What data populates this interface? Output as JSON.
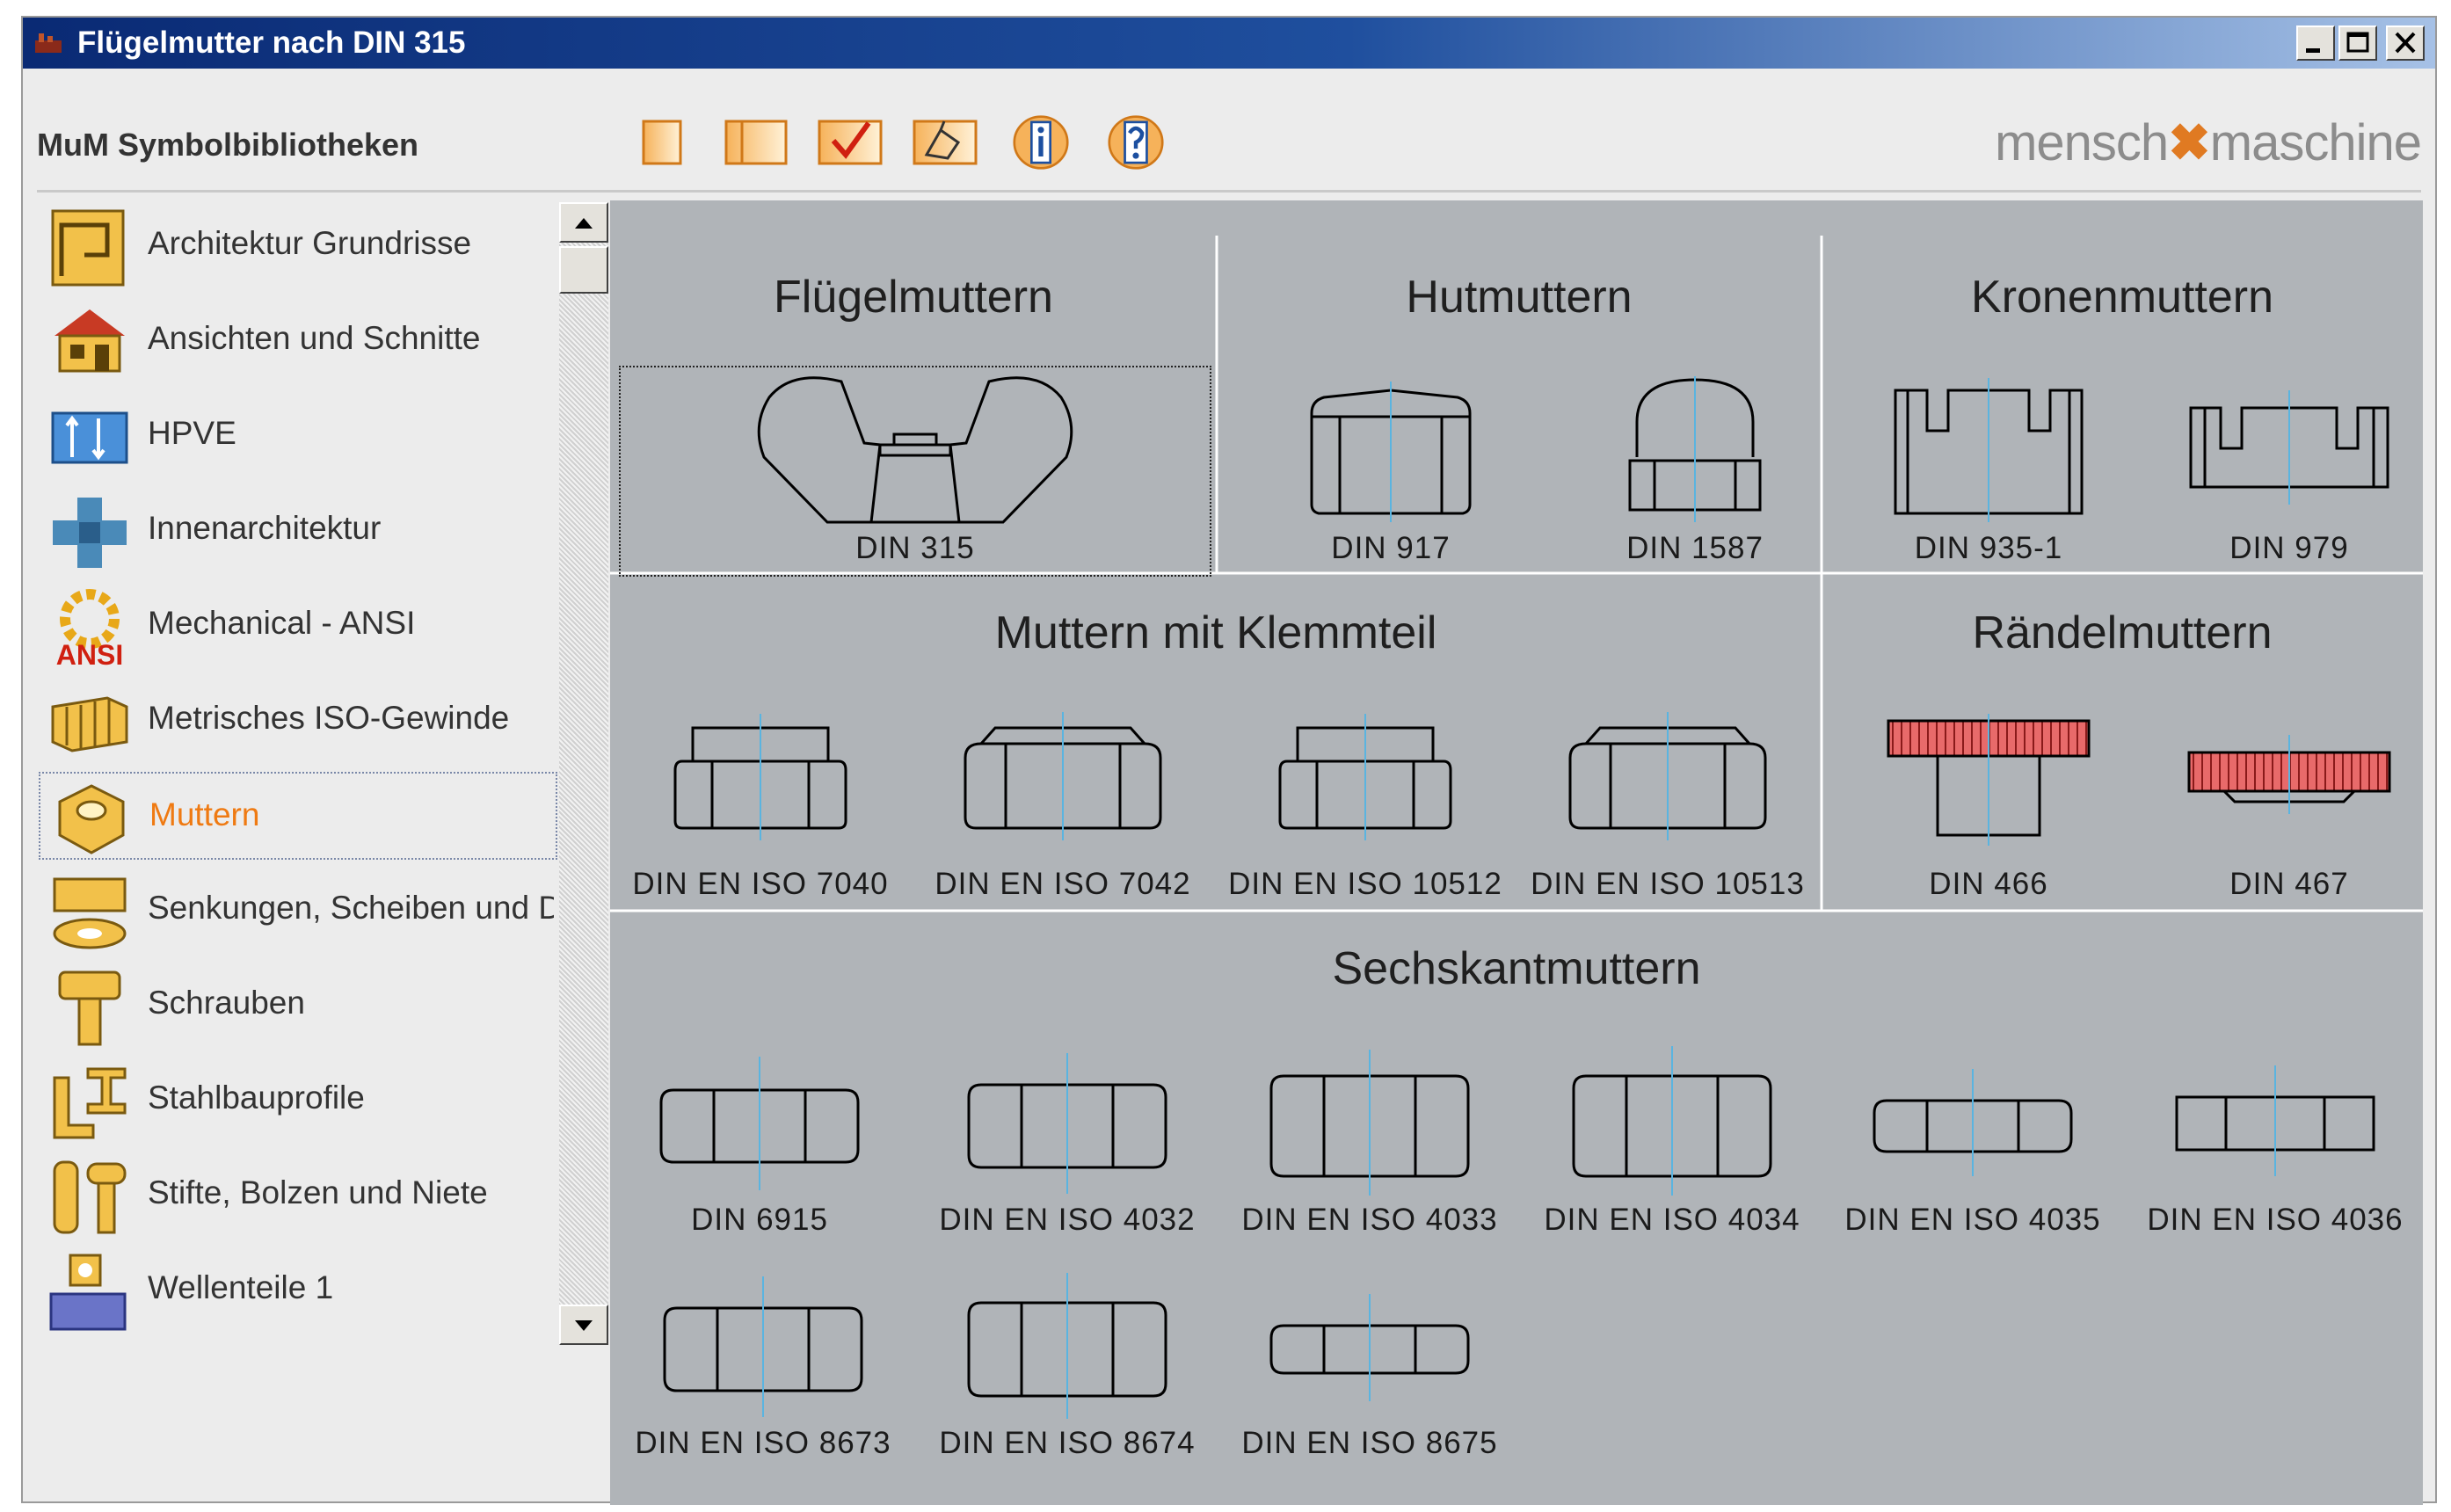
{
  "window": {
    "title": "Flügelmutter nach DIN 315"
  },
  "brand": {
    "library_title": "MuM Symbolbibliotheken",
    "logo_left": "mensch",
    "logo_right": "maschine",
    "toolbar": [
      "new-icon",
      "panel-icon",
      "checkmark-icon",
      "edit-icon",
      "info-icon",
      "help-icon"
    ]
  },
  "sidebar": {
    "items": [
      {
        "label": "Architektur Grundrisse",
        "icon": "floorplan-icon"
      },
      {
        "label": "Ansichten und Schnitte",
        "icon": "house-icon"
      },
      {
        "label": "HPVE",
        "icon": "hpve-icon"
      },
      {
        "label": "Innenarchitektur",
        "icon": "interior-icon"
      },
      {
        "label": "Mechanical - ANSI",
        "icon": "ansi-gear-icon",
        "badge": "ANSI"
      },
      {
        "label": "Metrisches ISO-Gewinde",
        "icon": "thread-icon"
      },
      {
        "label": "Muttern",
        "icon": "nut-icon",
        "selected": true
      },
      {
        "label": "Senkungen, Scheiben und Du",
        "icon": "washer-icon"
      },
      {
        "label": "Schrauben",
        "icon": "screw-icon"
      },
      {
        "label": "Stahlbauprofile",
        "icon": "steel-profile-icon"
      },
      {
        "label": "Stifte, Bolzen und Niete",
        "icon": "pin-icon"
      },
      {
        "label": "Wellenteile 1",
        "icon": "shaft-icon"
      }
    ]
  },
  "sections": [
    {
      "title": "Flügelmuttern",
      "symbols": [
        {
          "label": "DIN 315",
          "shape": "wing",
          "selected": true
        }
      ]
    },
    {
      "title": "Hutmuttern",
      "symbols": [
        {
          "label": "DIN 917",
          "shape": "cap-low"
        },
        {
          "label": "DIN 1587",
          "shape": "cap-dome"
        }
      ]
    },
    {
      "title": "Kronenmuttern",
      "symbols": [
        {
          "label": "DIN 935-1",
          "shape": "castle-tall"
        },
        {
          "label": "DIN 979",
          "shape": "castle-low"
        }
      ]
    },
    {
      "title": "Muttern mit Klemmteil",
      "symbols": [
        {
          "label": "DIN EN ISO 7040",
          "shape": "clamp-a"
        },
        {
          "label": "DIN EN ISO 7042",
          "shape": "clamp-b"
        },
        {
          "label": "DIN EN ISO 10512",
          "shape": "clamp-a"
        },
        {
          "label": "DIN EN ISO 10513",
          "shape": "clamp-b"
        }
      ]
    },
    {
      "title": "Rändelmuttern",
      "symbols": [
        {
          "label": "DIN 466",
          "shape": "knurl-tall"
        },
        {
          "label": "DIN 467",
          "shape": "knurl-flat"
        }
      ]
    },
    {
      "title": "Sechskantmuttern",
      "symbols": [
        {
          "label": "DIN 6915",
          "shape": "hex"
        },
        {
          "label": "DIN EN ISO 4032",
          "shape": "hex"
        },
        {
          "label": "DIN EN ISO 4033",
          "shape": "hex-tall"
        },
        {
          "label": "DIN EN ISO 4034",
          "shape": "hex-tall"
        },
        {
          "label": "DIN EN ISO 4035",
          "shape": "hex-thin"
        },
        {
          "label": "DIN EN ISO 4036",
          "shape": "hex-square"
        },
        {
          "label": "DIN EN ISO 8673",
          "shape": "hex"
        },
        {
          "label": "DIN EN ISO 8674",
          "shape": "hex"
        },
        {
          "label": "DIN EN ISO 8675",
          "shape": "hex-thin"
        }
      ]
    }
  ],
  "colors": {
    "accent_orange": "#ef7a12",
    "panel_gray": "#b0b4b8",
    "title_blue": "#0a2a74",
    "knurl_red": "#e86a6a",
    "centerline_blue": "#5ab4e0"
  }
}
